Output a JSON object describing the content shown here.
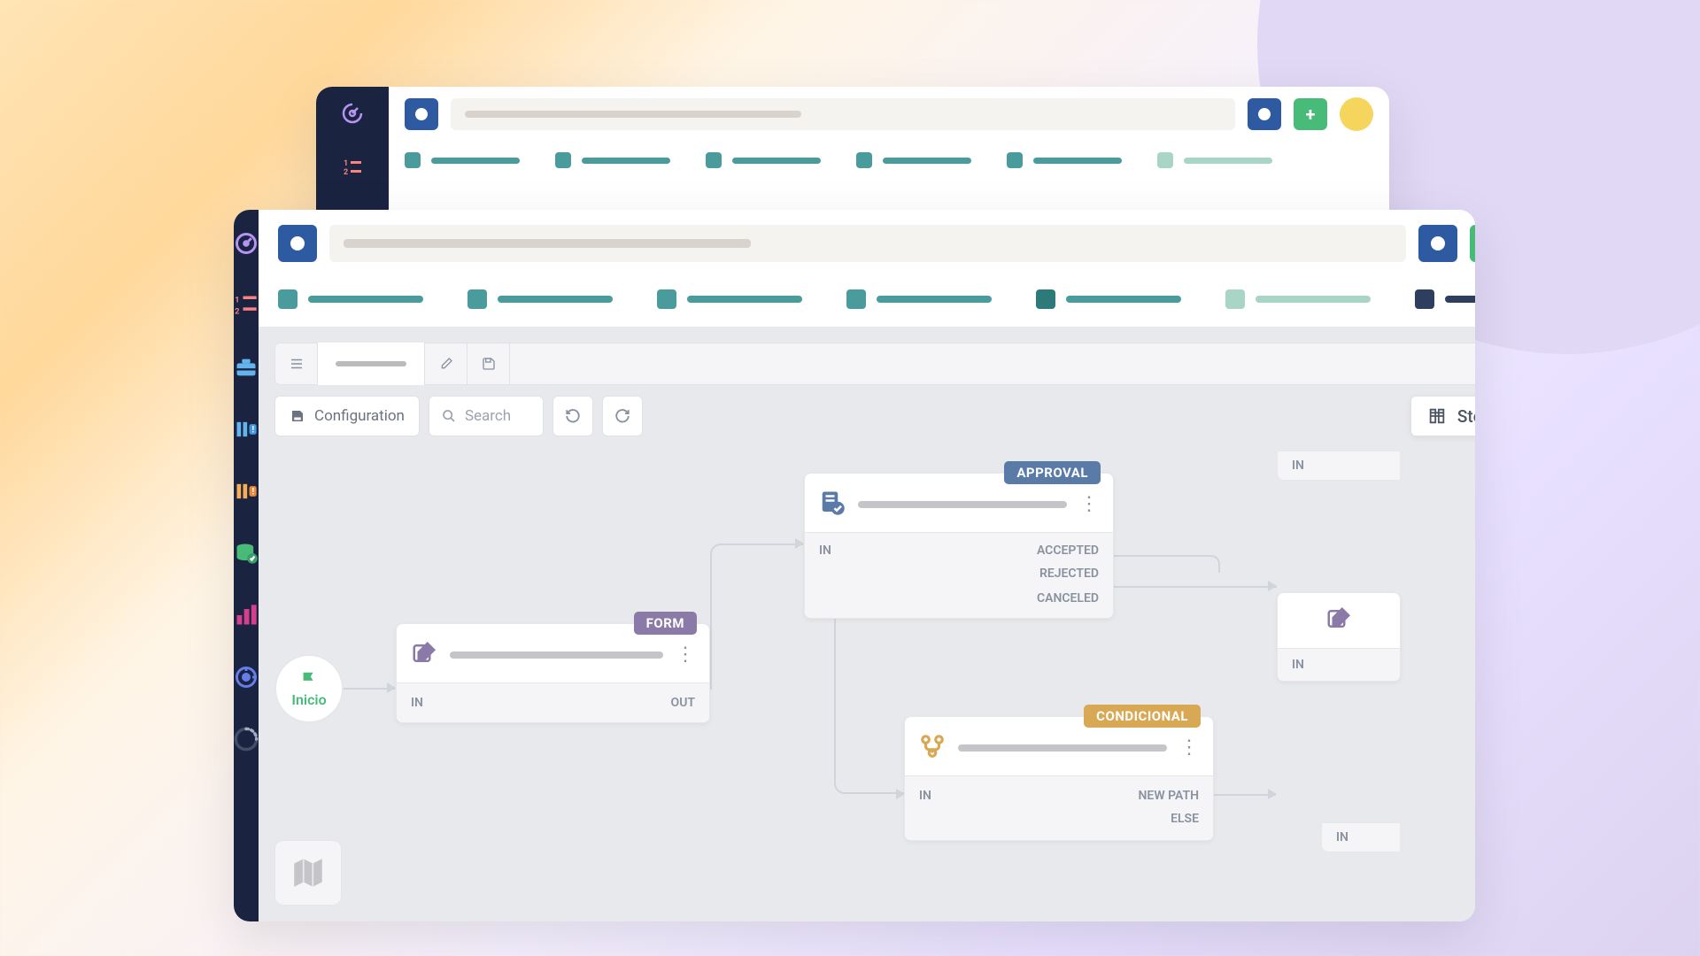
{
  "topbar": {
    "add_label": "+"
  },
  "subtoolbar": {
    "configuration_label": "Configuration",
    "search_placeholder": "Search",
    "steps_menu_label": "Steps Menu"
  },
  "workflow": {
    "start": {
      "label": "Inicio"
    },
    "form": {
      "tag": "FORM",
      "port_in": "IN",
      "port_out": "OUT"
    },
    "approval": {
      "tag": "APPROVAL",
      "port_in": "IN",
      "port_accepted": "ACCEPTED",
      "port_rejected": "REJECTED",
      "port_canceled": "CANCELED"
    },
    "conditional": {
      "tag": "CONDICIONAL",
      "port_in": "IN",
      "port_newpath": "NEW PATH",
      "port_else": "ELSE"
    },
    "partial1": {
      "port_in": "IN"
    },
    "partial2": {
      "port_in": "IN"
    },
    "partial3": {
      "port_in": "IN"
    }
  }
}
